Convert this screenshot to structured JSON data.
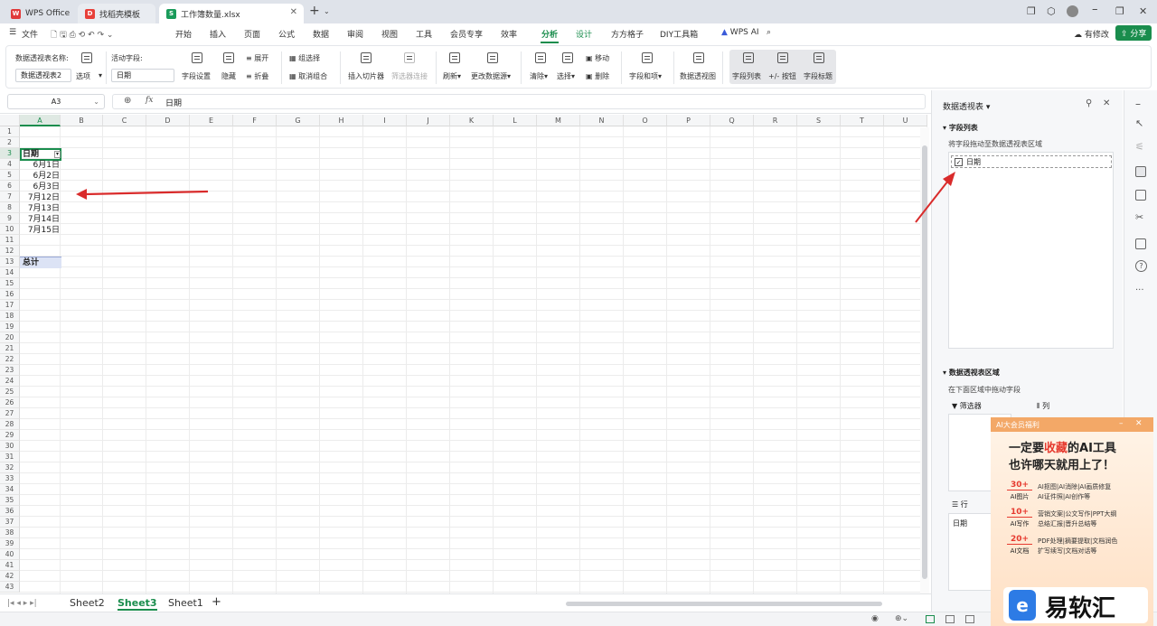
{
  "tabs": {
    "wps": "WPS Office",
    "template": "找稻壳模板",
    "file": "工作簿数量.xlsx"
  },
  "menu": {
    "file": "文件",
    "items": [
      "开始",
      "插入",
      "页面",
      "公式",
      "数据",
      "审阅",
      "视图",
      "工具",
      "会员专享",
      "效率",
      "分析",
      "设计",
      "方方格子",
      "DIY工具箱"
    ],
    "wpsai": "WPS AI",
    "modify": "有修改",
    "share": "分享"
  },
  "ribbon": {
    "pivot_name_label": "数据透视表名称:",
    "pivot_name_value": "数据透视表2",
    "options": "选项",
    "active_field_label": "活动字段:",
    "active_field_value": "日期",
    "field_settings": "字段设置",
    "hide": "隐藏",
    "expand": "展开",
    "collapse": "折叠",
    "group_selection": "组选择",
    "ungroup": "取消组合",
    "insert_slicer": "插入切片器",
    "filter_connection": "筛选器连接",
    "refresh": "刷新",
    "change_source": "更改数据源",
    "clear": "清除",
    "select": "选择",
    "move": "移动",
    "delete": "删除",
    "fields_items": "字段和项",
    "pivot_view": "数据透视图",
    "field_list": "字段列表",
    "plusminus_buttons": "+/- 按钮",
    "field_headers": "字段标题"
  },
  "formula": {
    "cell_ref": "A3",
    "fx": "fx",
    "content": "日期"
  },
  "grid": {
    "columns": [
      "A",
      "B",
      "C",
      "D",
      "E",
      "F",
      "G",
      "H",
      "I",
      "J",
      "K",
      "L",
      "M",
      "N",
      "O",
      "P",
      "Q",
      "R",
      "S",
      "T",
      "U"
    ],
    "rows": [
      "1",
      "2",
      "3",
      "4",
      "5",
      "6",
      "7",
      "8",
      "9",
      "10",
      "11",
      "12",
      "13",
      "14",
      "15",
      "16",
      "17",
      "18",
      "19",
      "20",
      "21",
      "22",
      "23",
      "24",
      "25",
      "26",
      "27",
      "28",
      "29",
      "30",
      "31",
      "32",
      "33",
      "34",
      "35",
      "36",
      "37",
      "38",
      "39",
      "40",
      "41",
      "42",
      "43"
    ],
    "header": "日期",
    "dates": [
      "6月1日",
      "6月2日",
      "6月3日",
      "7月12日",
      "7月13日",
      "7月14日",
      "7月15日"
    ],
    "total": "总计"
  },
  "sheets": [
    "Sheet2",
    "Sheet3",
    "Sheet1"
  ],
  "active_sheet": "Sheet3",
  "panel": {
    "title": "数据透视表",
    "field_list": "字段列表",
    "drag_hint": "将字段拖动至数据透视表区域",
    "field": "日期",
    "areas": "数据透视表区域",
    "areas_hint": "在下面区域中拖动字段",
    "filter": "筛选器",
    "column": "列",
    "row": "行",
    "row_field": "日期"
  },
  "ad": {
    "header": "AI大会员福利",
    "line1a": "一定要",
    "line1b": "收藏",
    "line1c": "的AI工具",
    "line2": "也许哪天就用上了！",
    "items": [
      {
        "num": "30+",
        "label": "AI图片",
        "desc1": "AI抠图|AI消除|AI画质修复",
        "desc2": "AI证件照|AI创作等"
      },
      {
        "num": "10+",
        "label": "AI写作",
        "desc1": "营销文案|公文写作|PPT大纲",
        "desc2": "总结汇报|晋升总结等"
      },
      {
        "num": "20+",
        "label": "AI文档",
        "desc1": "PDF处理|摘要提取|文档润色",
        "desc2": "扩写续写|文档对话等"
      }
    ],
    "brand": "易软汇"
  },
  "colors": {
    "accent": "#1a8d4d",
    "arrow": "#d92b2b",
    "active_tab": "#ffffff"
  }
}
